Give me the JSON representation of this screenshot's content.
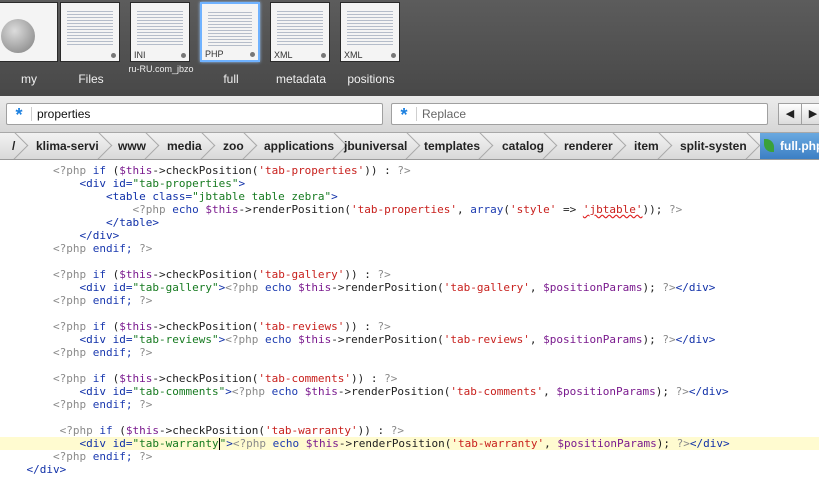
{
  "shelf": {
    "tiles": [
      {
        "label": "my",
        "tag": "",
        "kind": "drive"
      },
      {
        "label": "Files",
        "tag": "",
        "kind": "doc"
      },
      {
        "label": "ru-RU.com_jbzo",
        "tag": "INI",
        "kind": "doc"
      },
      {
        "label": "full",
        "tag": "PHP",
        "kind": "doc",
        "selected": true
      },
      {
        "label": "metadata",
        "tag": "XML",
        "kind": "doc"
      },
      {
        "label": "positions",
        "tag": "XML",
        "kind": "doc"
      }
    ]
  },
  "findbar": {
    "search_value": "properties",
    "replace_placeholder": "Replace",
    "prev_icon": "◀",
    "next_icon": "▶"
  },
  "breadcrumb": {
    "items": [
      "/",
      "klima-servi",
      "www",
      "media",
      "zoo",
      "applications",
      "jbuniversal",
      "templates",
      "catalog",
      "renderer",
      "item",
      "split-systen"
    ],
    "current": "full.php"
  },
  "editor": {
    "current_line": 22,
    "lines": [
      [
        [
          "        ",
          "plain"
        ],
        [
          "<?php",
          "php"
        ],
        [
          " if ",
          "kw"
        ],
        [
          "(",
          "plain"
        ],
        [
          "$this",
          "var"
        ],
        [
          "->",
          "plain"
        ],
        [
          "checkPosition",
          "fn"
        ],
        [
          "(",
          "plain"
        ],
        [
          "'tab-properties'",
          "str"
        ],
        [
          ")) : ",
          "plain"
        ],
        [
          "?>",
          "php"
        ]
      ],
      [
        [
          "            ",
          "plain"
        ],
        [
          "<div ",
          "tag"
        ],
        [
          "id=",
          "attr"
        ],
        [
          "\"tab-properties\"",
          "val"
        ],
        [
          ">",
          "tag"
        ]
      ],
      [
        [
          "                ",
          "plain"
        ],
        [
          "<table ",
          "tag"
        ],
        [
          "class=",
          "attr"
        ],
        [
          "\"jbtable table zebra\"",
          "val"
        ],
        [
          ">",
          "tag"
        ]
      ],
      [
        [
          "                    ",
          "plain"
        ],
        [
          "<?php",
          "php"
        ],
        [
          " echo ",
          "kw"
        ],
        [
          "$this",
          "var"
        ],
        [
          "->",
          "plain"
        ],
        [
          "renderPosition",
          "fn"
        ],
        [
          "(",
          "plain"
        ],
        [
          "'tab-properties'",
          "str"
        ],
        [
          ", ",
          "plain"
        ],
        [
          "array",
          "kw"
        ],
        [
          "(",
          "plain"
        ],
        [
          "'style'",
          "str"
        ],
        [
          " => ",
          "plain"
        ],
        [
          "'jbtable'",
          "err"
        ],
        [
          ")); ",
          "plain"
        ],
        [
          "?>",
          "php"
        ]
      ],
      [
        [
          "                ",
          "plain"
        ],
        [
          "</table>",
          "tag"
        ]
      ],
      [
        [
          "            ",
          "plain"
        ],
        [
          "</div>",
          "tag"
        ]
      ],
      [
        [
          "        ",
          "plain"
        ],
        [
          "<?php",
          "php"
        ],
        [
          " endif; ",
          "kw"
        ],
        [
          "?>",
          "php"
        ]
      ],
      [
        [
          "",
          "plain"
        ]
      ],
      [
        [
          "        ",
          "plain"
        ],
        [
          "<?php",
          "php"
        ],
        [
          " if ",
          "kw"
        ],
        [
          "(",
          "plain"
        ],
        [
          "$this",
          "var"
        ],
        [
          "->",
          "plain"
        ],
        [
          "checkPosition",
          "fn"
        ],
        [
          "(",
          "plain"
        ],
        [
          "'tab-gallery'",
          "str"
        ],
        [
          ")) : ",
          "plain"
        ],
        [
          "?>",
          "php"
        ]
      ],
      [
        [
          "            ",
          "plain"
        ],
        [
          "<div ",
          "tag"
        ],
        [
          "id=",
          "attr"
        ],
        [
          "\"tab-gallery\"",
          "val"
        ],
        [
          ">",
          "tag"
        ],
        [
          "<?php",
          "php"
        ],
        [
          " echo ",
          "kw"
        ],
        [
          "$this",
          "var"
        ],
        [
          "->",
          "plain"
        ],
        [
          "renderPosition",
          "fn"
        ],
        [
          "(",
          "plain"
        ],
        [
          "'tab-gallery'",
          "str"
        ],
        [
          ", ",
          "plain"
        ],
        [
          "$positionParams",
          "var"
        ],
        [
          "); ",
          "plain"
        ],
        [
          "?>",
          "php"
        ],
        [
          "</div>",
          "tag"
        ]
      ],
      [
        [
          "        ",
          "plain"
        ],
        [
          "<?php",
          "php"
        ],
        [
          " endif; ",
          "kw"
        ],
        [
          "?>",
          "php"
        ]
      ],
      [
        [
          "",
          "plain"
        ]
      ],
      [
        [
          "        ",
          "plain"
        ],
        [
          "<?php",
          "php"
        ],
        [
          " if ",
          "kw"
        ],
        [
          "(",
          "plain"
        ],
        [
          "$this",
          "var"
        ],
        [
          "->",
          "plain"
        ],
        [
          "checkPosition",
          "fn"
        ],
        [
          "(",
          "plain"
        ],
        [
          "'tab-reviews'",
          "str"
        ],
        [
          ")) : ",
          "plain"
        ],
        [
          "?>",
          "php"
        ]
      ],
      [
        [
          "            ",
          "plain"
        ],
        [
          "<div ",
          "tag"
        ],
        [
          "id=",
          "attr"
        ],
        [
          "\"tab-reviews\"",
          "val"
        ],
        [
          ">",
          "tag"
        ],
        [
          "<?php",
          "php"
        ],
        [
          " echo ",
          "kw"
        ],
        [
          "$this",
          "var"
        ],
        [
          "->",
          "plain"
        ],
        [
          "renderPosition",
          "fn"
        ],
        [
          "(",
          "plain"
        ],
        [
          "'tab-reviews'",
          "str"
        ],
        [
          ", ",
          "plain"
        ],
        [
          "$positionParams",
          "var"
        ],
        [
          "); ",
          "plain"
        ],
        [
          "?>",
          "php"
        ],
        [
          "</div>",
          "tag"
        ]
      ],
      [
        [
          "        ",
          "plain"
        ],
        [
          "<?php",
          "php"
        ],
        [
          " endif; ",
          "kw"
        ],
        [
          "?>",
          "php"
        ]
      ],
      [
        [
          "",
          "plain"
        ]
      ],
      [
        [
          "        ",
          "plain"
        ],
        [
          "<?php",
          "php"
        ],
        [
          " if ",
          "kw"
        ],
        [
          "(",
          "plain"
        ],
        [
          "$this",
          "var"
        ],
        [
          "->",
          "plain"
        ],
        [
          "checkPosition",
          "fn"
        ],
        [
          "(",
          "plain"
        ],
        [
          "'tab-comments'",
          "str"
        ],
        [
          ")) : ",
          "plain"
        ],
        [
          "?>",
          "php"
        ]
      ],
      [
        [
          "            ",
          "plain"
        ],
        [
          "<div ",
          "tag"
        ],
        [
          "id=",
          "attr"
        ],
        [
          "\"tab-comments\"",
          "val"
        ],
        [
          ">",
          "tag"
        ],
        [
          "<?php",
          "php"
        ],
        [
          " echo ",
          "kw"
        ],
        [
          "$this",
          "var"
        ],
        [
          "->",
          "plain"
        ],
        [
          "renderPosition",
          "fn"
        ],
        [
          "(",
          "plain"
        ],
        [
          "'tab-comments'",
          "str"
        ],
        [
          ", ",
          "plain"
        ],
        [
          "$positionParams",
          "var"
        ],
        [
          "); ",
          "plain"
        ],
        [
          "?>",
          "php"
        ],
        [
          "</div>",
          "tag"
        ]
      ],
      [
        [
          "        ",
          "plain"
        ],
        [
          "<?php",
          "php"
        ],
        [
          " endif; ",
          "kw"
        ],
        [
          "?>",
          "php"
        ]
      ],
      [
        [
          "",
          "plain"
        ]
      ],
      [
        [
          "         ",
          "plain"
        ],
        [
          "<?php",
          "php"
        ],
        [
          " if ",
          "kw"
        ],
        [
          "(",
          "plain"
        ],
        [
          "$this",
          "var"
        ],
        [
          "->",
          "plain"
        ],
        [
          "checkPosition",
          "fn"
        ],
        [
          "(",
          "plain"
        ],
        [
          "'tab-warranty'",
          "str"
        ],
        [
          ")) : ",
          "plain"
        ],
        [
          "?>",
          "php"
        ]
      ],
      [
        [
          "            ",
          "plain"
        ],
        [
          "<div ",
          "tag"
        ],
        [
          "id=",
          "attr"
        ],
        [
          "\"tab-warranty",
          "val"
        ],
        [
          "CARET",
          "caret"
        ],
        [
          "\"",
          "val"
        ],
        [
          ">",
          "tag"
        ],
        [
          "<?php",
          "php"
        ],
        [
          " echo ",
          "kw"
        ],
        [
          "$this",
          "var"
        ],
        [
          "->",
          "plain"
        ],
        [
          "renderPosition",
          "fn"
        ],
        [
          "(",
          "plain"
        ],
        [
          "'tab-warranty'",
          "str"
        ],
        [
          ", ",
          "plain"
        ],
        [
          "$positionParams",
          "var"
        ],
        [
          "); ",
          "plain"
        ],
        [
          "?>",
          "php"
        ],
        [
          "</div>",
          "tag"
        ]
      ],
      [
        [
          "        ",
          "plain"
        ],
        [
          "<?php",
          "php"
        ],
        [
          " endif; ",
          "kw"
        ],
        [
          "?>",
          "php"
        ]
      ],
      [
        [
          "    ",
          "plain"
        ],
        [
          "</div>",
          "tag"
        ]
      ]
    ]
  }
}
